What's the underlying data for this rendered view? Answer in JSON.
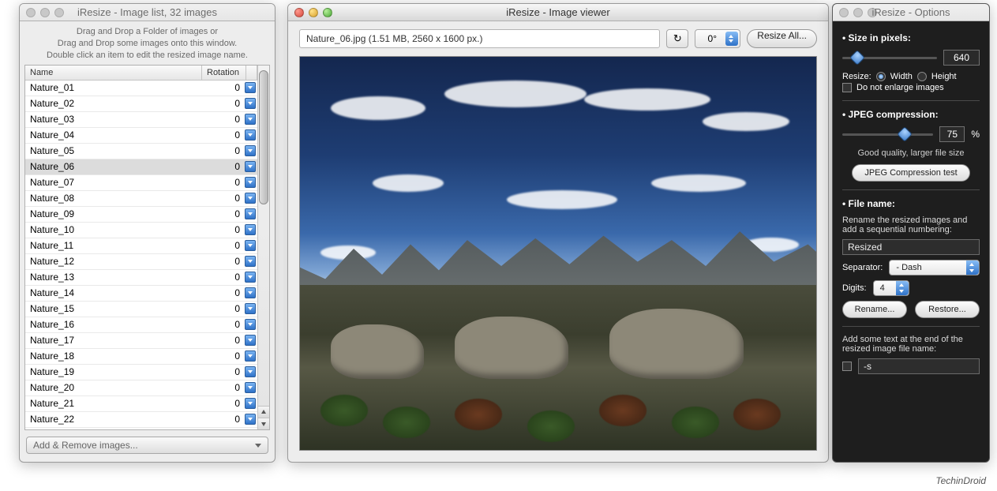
{
  "list": {
    "title": "iResize - Image list, 32 images",
    "hint_l1": "Drag and Drop a Folder of images or",
    "hint_l2": "Drag and Drop some images onto this window.",
    "hint_l3": "Double click an item to edit the resized image name.",
    "col_name": "Name",
    "col_rotation": "Rotation",
    "add_remove": "Add & Remove images...",
    "selected": "Nature_06",
    "rows": [
      {
        "name": "Nature_01",
        "rot": "0"
      },
      {
        "name": "Nature_02",
        "rot": "0"
      },
      {
        "name": "Nature_03",
        "rot": "0"
      },
      {
        "name": "Nature_04",
        "rot": "0"
      },
      {
        "name": "Nature_05",
        "rot": "0"
      },
      {
        "name": "Nature_06",
        "rot": "0"
      },
      {
        "name": "Nature_07",
        "rot": "0"
      },
      {
        "name": "Nature_08",
        "rot": "0"
      },
      {
        "name": "Nature_09",
        "rot": "0"
      },
      {
        "name": "Nature_10",
        "rot": "0"
      },
      {
        "name": "Nature_11",
        "rot": "0"
      },
      {
        "name": "Nature_12",
        "rot": "0"
      },
      {
        "name": "Nature_13",
        "rot": "0"
      },
      {
        "name": "Nature_14",
        "rot": "0"
      },
      {
        "name": "Nature_15",
        "rot": "0"
      },
      {
        "name": "Nature_16",
        "rot": "0"
      },
      {
        "name": "Nature_17",
        "rot": "0"
      },
      {
        "name": "Nature_18",
        "rot": "0"
      },
      {
        "name": "Nature_19",
        "rot": "0"
      },
      {
        "name": "Nature_20",
        "rot": "0"
      },
      {
        "name": "Nature_21",
        "rot": "0"
      },
      {
        "name": "Nature_22",
        "rot": "0"
      }
    ]
  },
  "viewer": {
    "title": "iResize - Image viewer",
    "file_label": "Nature_06.jpg  (1.51 MB, 2560 x 1600 px.)",
    "rotate_icon": "↻",
    "degree": "0°",
    "resize_all": "Resize All..."
  },
  "options": {
    "title": "iResize - Options",
    "size_title": "Size in pixels:",
    "size_value": "640",
    "size_pos_pct": 10,
    "resize_label": "Resize:",
    "width_label": "Width",
    "height_label": "Height",
    "dimension": "width",
    "no_enlarge": "Do not enlarge images",
    "no_enlarge_checked": false,
    "jpeg_title": "JPEG compression:",
    "jpeg_value": "75",
    "jpeg_pos_pct": 62,
    "pct": "%",
    "jpeg_note": "Good quality, larger file size",
    "jpeg_test": "JPEG Compression test",
    "fname_title": "File name:",
    "fname_hint": "Rename the resized images and add a sequential numbering:",
    "fname_value": "Resized",
    "sep_label": "Separator:",
    "sep_value": "- Dash",
    "digits_label": "Digits:",
    "digits_value": "4",
    "rename": "Rename...",
    "restore": "Restore...",
    "suffix_hint": "Add some text at the end of the resized image file name:",
    "suffix_checked": false,
    "suffix_value": "-s"
  },
  "credit": "TechinDroid"
}
